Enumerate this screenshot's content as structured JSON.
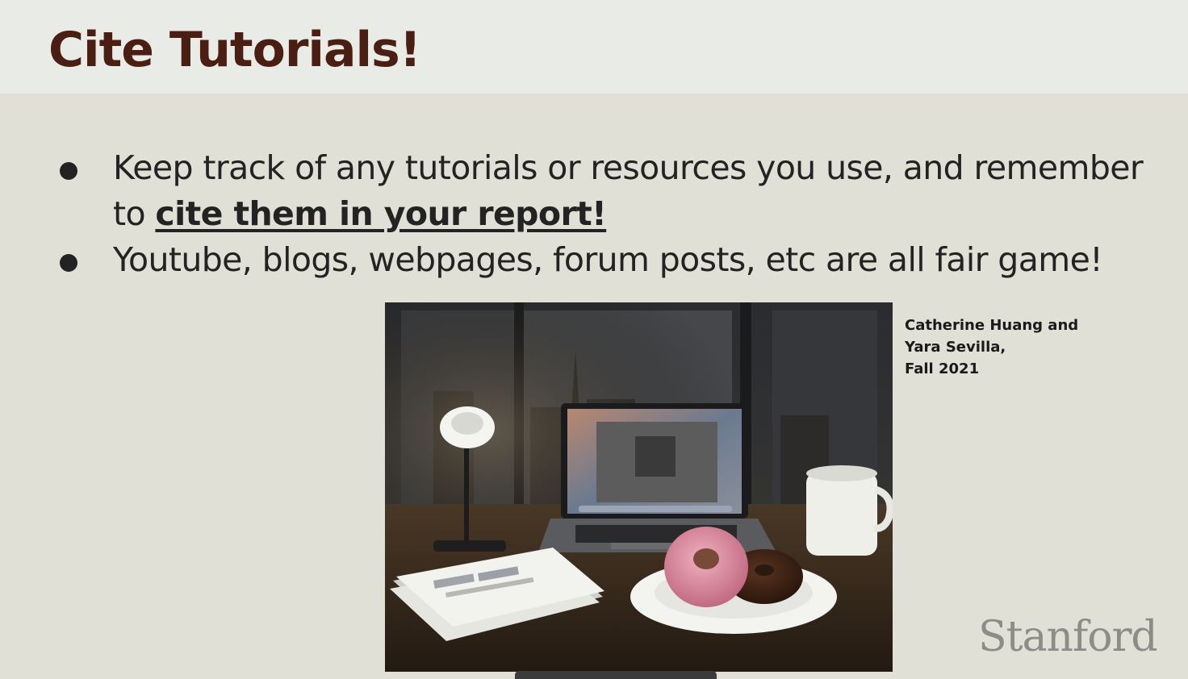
{
  "slide": {
    "title": "Cite Tutorials!",
    "bullets": [
      {
        "text": "Keep track of any tutorials or resources you use, and remember to ",
        "emphasis": "cite them in your report!"
      },
      {
        "text": "Youtube, blogs, webpages, forum posts, etc are all fair game!"
      }
    ],
    "image_credit": [
      "Catherine Huang and",
      "Yara Sevilla,",
      "Fall 2021"
    ],
    "logo": "Stanford"
  },
  "colors": {
    "title": "#4a1e12",
    "background": "#e0e0d6",
    "header_band": "#e9ebe6",
    "text": "#232323",
    "logo": "#8c8c88"
  }
}
